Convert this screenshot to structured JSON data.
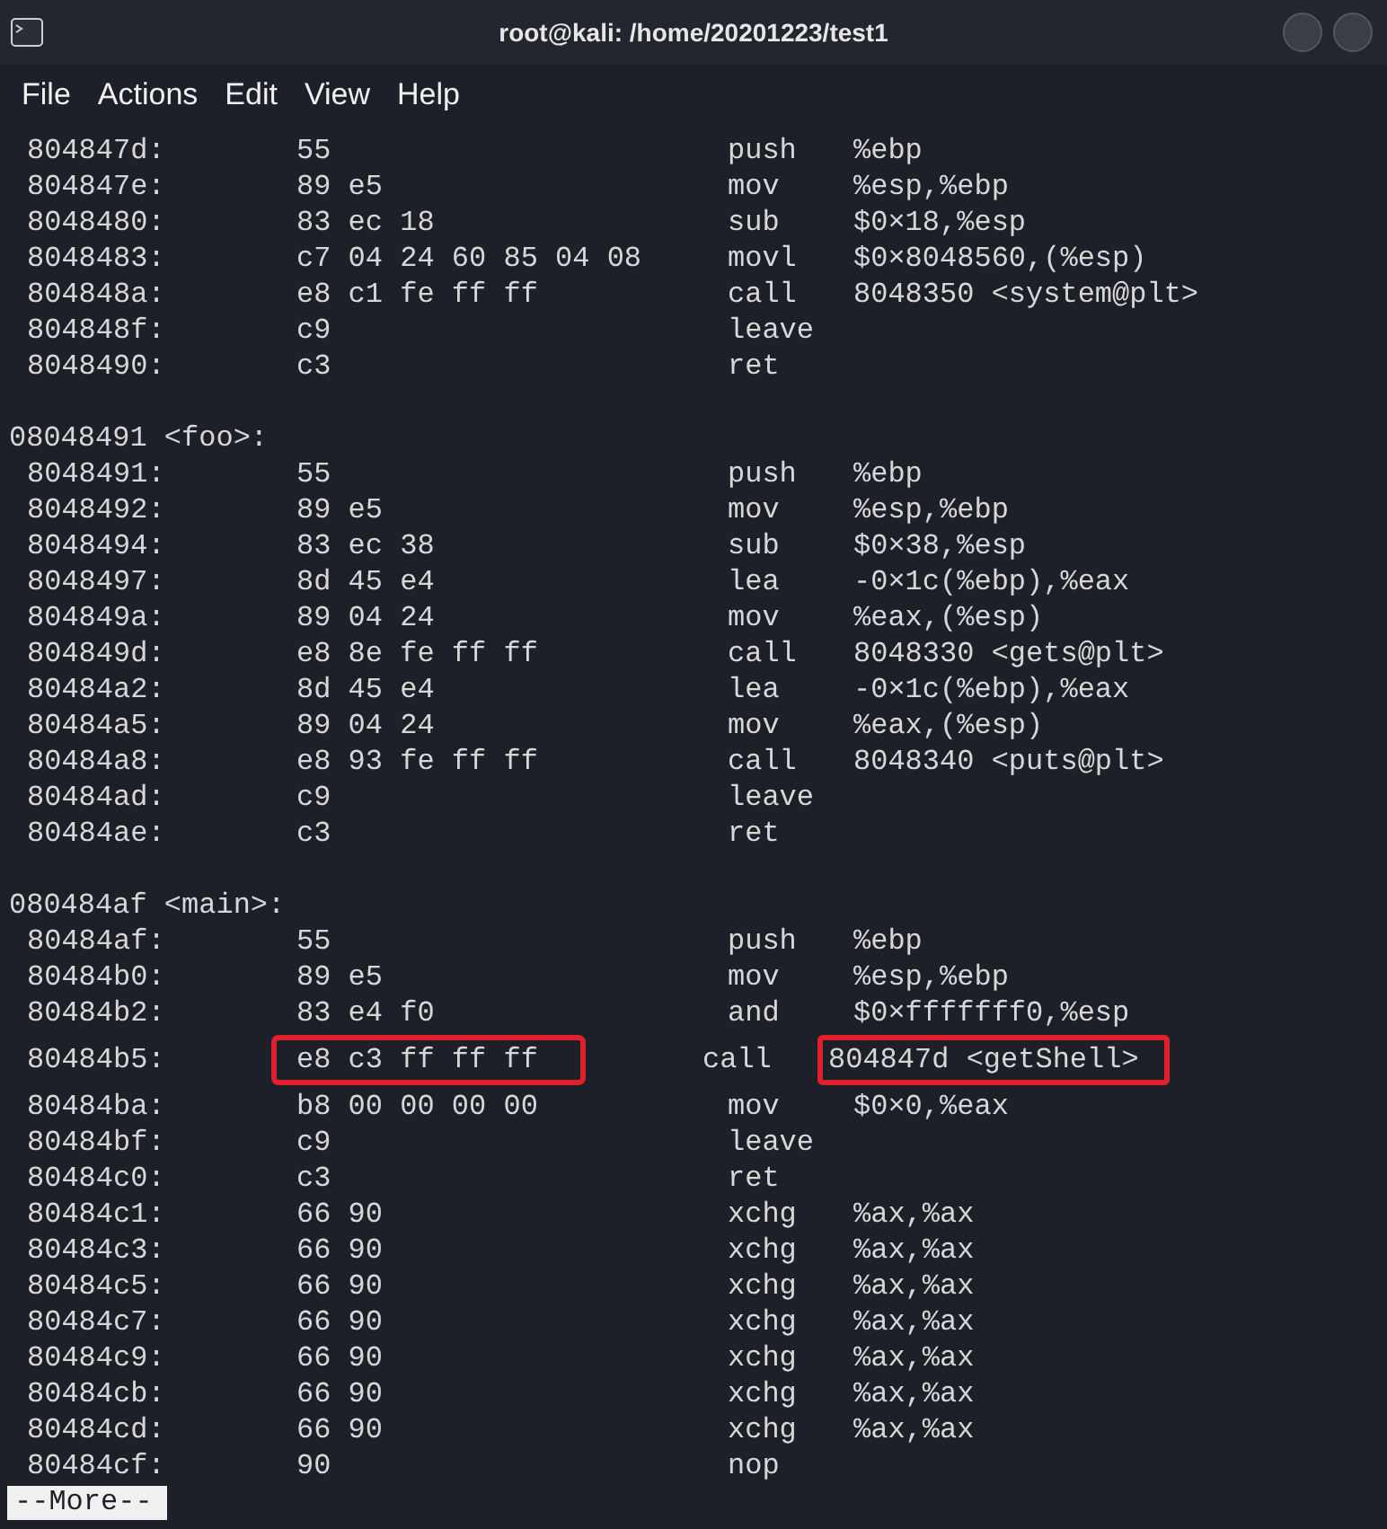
{
  "window": {
    "title": "root@kali: /home/20201223/test1"
  },
  "menu": [
    "File",
    "Actions",
    "Edit",
    "View",
    "Help"
  ],
  "lines": [
    {
      "kind": "ins",
      "address": "804847d:",
      "bytes": "55",
      "mnemonic": "push",
      "operand": "%ebp"
    },
    {
      "kind": "ins",
      "address": "804847e:",
      "bytes": "89 e5",
      "mnemonic": "mov",
      "operand": "%esp,%ebp"
    },
    {
      "kind": "ins",
      "address": "8048480:",
      "bytes": "83 ec 18",
      "mnemonic": "sub",
      "operand": "$0×18,%esp"
    },
    {
      "kind": "ins",
      "address": "8048483:",
      "bytes": "c7 04 24 60 85 04 08",
      "mnemonic": "movl",
      "operand": "$0×8048560,(%esp)"
    },
    {
      "kind": "ins",
      "address": "804848a:",
      "bytes": "e8 c1 fe ff ff",
      "mnemonic": "call",
      "operand": "8048350 <system@plt>"
    },
    {
      "kind": "ins",
      "address": "804848f:",
      "bytes": "c9",
      "mnemonic": "leave"
    },
    {
      "kind": "ins",
      "address": "8048490:",
      "bytes": "c3",
      "mnemonic": "ret"
    },
    {
      "kind": "blank"
    },
    {
      "kind": "label",
      "text": "08048491 <foo>:"
    },
    {
      "kind": "ins",
      "address": "8048491:",
      "bytes": "55",
      "mnemonic": "push",
      "operand": "%ebp"
    },
    {
      "kind": "ins",
      "address": "8048492:",
      "bytes": "89 e5",
      "mnemonic": "mov",
      "operand": "%esp,%ebp"
    },
    {
      "kind": "ins",
      "address": "8048494:",
      "bytes": "83 ec 38",
      "mnemonic": "sub",
      "operand": "$0×38,%esp"
    },
    {
      "kind": "ins",
      "address": "8048497:",
      "bytes": "8d 45 e4",
      "mnemonic": "lea",
      "operand": "-0×1c(%ebp),%eax"
    },
    {
      "kind": "ins",
      "address": "804849a:",
      "bytes": "89 04 24",
      "mnemonic": "mov",
      "operand": "%eax,(%esp)"
    },
    {
      "kind": "ins",
      "address": "804849d:",
      "bytes": "e8 8e fe ff ff",
      "mnemonic": "call",
      "operand": "8048330 <gets@plt>"
    },
    {
      "kind": "ins",
      "address": "80484a2:",
      "bytes": "8d 45 e4",
      "mnemonic": "lea",
      "operand": "-0×1c(%ebp),%eax"
    },
    {
      "kind": "ins",
      "address": "80484a5:",
      "bytes": "89 04 24",
      "mnemonic": "mov",
      "operand": "%eax,(%esp)"
    },
    {
      "kind": "ins",
      "address": "80484a8:",
      "bytes": "e8 93 fe ff ff",
      "mnemonic": "call",
      "operand": "8048340 <puts@plt>"
    },
    {
      "kind": "ins",
      "address": "80484ad:",
      "bytes": "c9",
      "mnemonic": "leave"
    },
    {
      "kind": "ins",
      "address": "80484ae:",
      "bytes": "c3",
      "mnemonic": "ret"
    },
    {
      "kind": "blank"
    },
    {
      "kind": "label",
      "text": "080484af <main>:"
    },
    {
      "kind": "ins",
      "address": "80484af:",
      "bytes": "55",
      "mnemonic": "push",
      "operand": "%ebp"
    },
    {
      "kind": "ins",
      "address": "80484b0:",
      "bytes": "89 e5",
      "mnemonic": "mov",
      "operand": "%esp,%ebp"
    },
    {
      "kind": "ins",
      "address": "80484b2:",
      "bytes": "83 e4 f0",
      "mnemonic": "and",
      "operand": "$0×fffffff0,%esp"
    },
    {
      "kind": "ins",
      "address": "80484b5:",
      "bytes": "e8 c3 ff ff ff",
      "mnemonic": "call",
      "operand": "804847d <getShell>",
      "highlighted": true
    },
    {
      "kind": "ins",
      "address": "80484ba:",
      "bytes": "b8 00 00 00 00",
      "mnemonic": "mov",
      "operand": "$0×0,%eax"
    },
    {
      "kind": "ins",
      "address": "80484bf:",
      "bytes": "c9",
      "mnemonic": "leave"
    },
    {
      "kind": "ins",
      "address": "80484c0:",
      "bytes": "c3",
      "mnemonic": "ret"
    },
    {
      "kind": "ins",
      "address": "80484c1:",
      "bytes": "66 90",
      "mnemonic": "xchg",
      "operand": "%ax,%ax"
    },
    {
      "kind": "ins",
      "address": "80484c3:",
      "bytes": "66 90",
      "mnemonic": "xchg",
      "operand": "%ax,%ax"
    },
    {
      "kind": "ins",
      "address": "80484c5:",
      "bytes": "66 90",
      "mnemonic": "xchg",
      "operand": "%ax,%ax"
    },
    {
      "kind": "ins",
      "address": "80484c7:",
      "bytes": "66 90",
      "mnemonic": "xchg",
      "operand": "%ax,%ax"
    },
    {
      "kind": "ins",
      "address": "80484c9:",
      "bytes": "66 90",
      "mnemonic": "xchg",
      "operand": "%ax,%ax"
    },
    {
      "kind": "ins",
      "address": "80484cb:",
      "bytes": "66 90",
      "mnemonic": "xchg",
      "operand": "%ax,%ax"
    },
    {
      "kind": "ins",
      "address": "80484cd:",
      "bytes": "66 90",
      "mnemonic": "xchg",
      "operand": "%ax,%ax"
    },
    {
      "kind": "ins",
      "address": "80484cf:",
      "bytes": "90",
      "mnemonic": "nop"
    }
  ],
  "pager": "--More--"
}
